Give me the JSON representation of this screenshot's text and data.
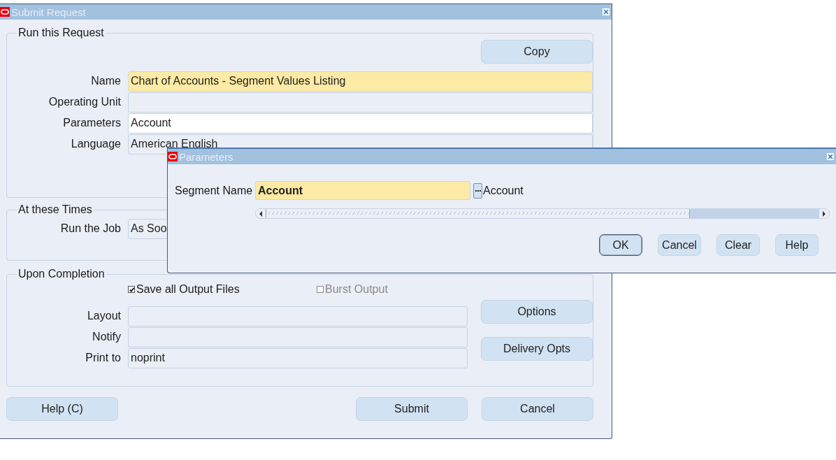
{
  "window": {
    "title": "Submit Request"
  },
  "run_request": {
    "legend": "Run this Request",
    "copy_button": {
      "label": "Copy"
    },
    "fields": [
      {
        "label": "Name",
        "value": "Chart of Accounts - Segment Values Listing",
        "kind": "required"
      },
      {
        "label": "Operating Unit",
        "kind": "readonly"
      },
      {
        "label": "Parameters",
        "value": "Account",
        "kind": "editable"
      },
      {
        "label": "Language",
        "value": "American English",
        "kind": "readonly"
      }
    ]
  },
  "times": {
    "legend": "At these Times",
    "fields": [
      {
        "label": "Run the Job",
        "value": "As Soo",
        "kind": "readonly"
      }
    ]
  },
  "completion": {
    "legend": "Upon Completion",
    "checkboxes": [
      {
        "label": "Save all Output Files",
        "checked": true,
        "disabled": false
      },
      {
        "label": "Burst Output",
        "checked": false,
        "disabled": true
      }
    ],
    "fields": [
      {
        "label": "Layout",
        "kind": "readonly"
      },
      {
        "label": "Notify",
        "kind": "readonly"
      },
      {
        "label": "Print to",
        "value": "noprint",
        "kind": "readonly"
      }
    ],
    "buttons": [
      {
        "label": "Options"
      },
      {
        "label": "Delivery Opts"
      }
    ]
  },
  "footer": {
    "left_buttons": [
      {
        "label": "Help (C)"
      }
    ],
    "right_buttons": [
      {
        "label": "Submit"
      },
      {
        "label": "Cancel"
      }
    ]
  },
  "dialog": {
    "title": "Parameters",
    "segment": {
      "label": "Segment Name",
      "value": "Account",
      "description": "Account"
    },
    "buttons": [
      {
        "label": "OK",
        "default": true
      },
      {
        "label": "Cancel",
        "default": false
      },
      {
        "label": "Clear",
        "default": false
      },
      {
        "label": "Help",
        "default": false
      }
    ]
  }
}
